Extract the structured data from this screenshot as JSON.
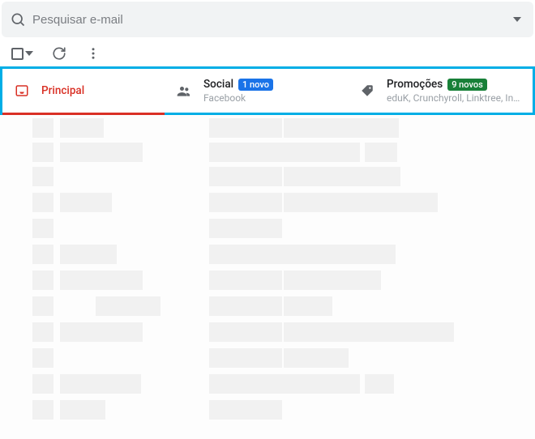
{
  "search": {
    "placeholder": "Pesquisar e-mail"
  },
  "tabs": {
    "primary": {
      "label": "Principal"
    },
    "social": {
      "label": "Social",
      "badge": "1 novo",
      "sub": "Facebook"
    },
    "promo": {
      "label": "Promoções",
      "badge": "9 novos",
      "sub": "eduK, Crunchyroll, Linktree, Ins…"
    }
  }
}
